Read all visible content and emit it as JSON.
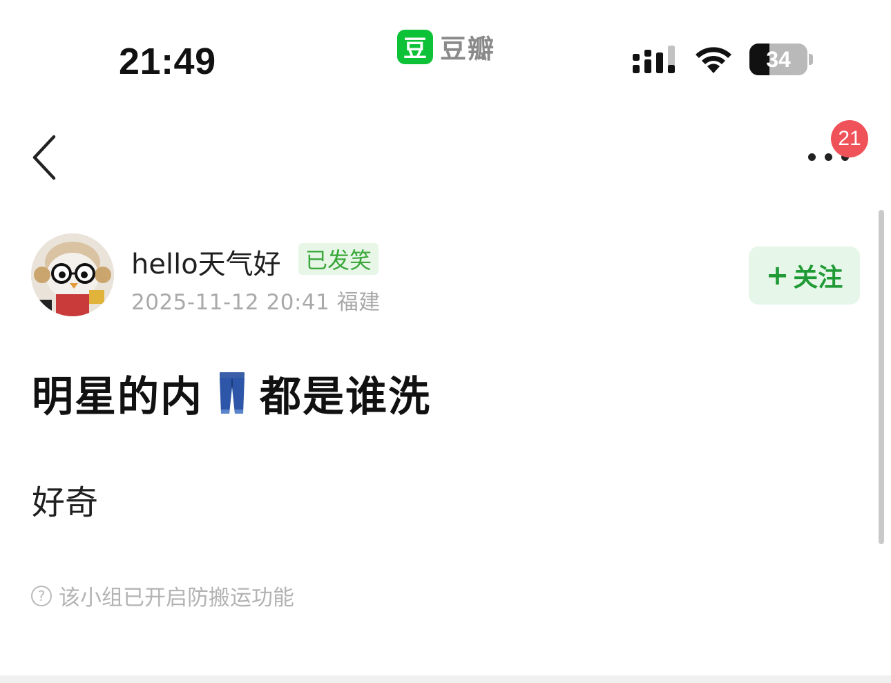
{
  "status_bar": {
    "time": "21:49",
    "app_logo_char": "豆",
    "app_name": "豆瓣",
    "battery_level": "34",
    "battery_fraction": 0.34,
    "icons": [
      "signal-icon",
      "wifi-icon",
      "battery-icon"
    ]
  },
  "nav": {
    "back_icon": "chevron-left-icon",
    "more_icon": "more-dots-icon",
    "notification_count": "21"
  },
  "author": {
    "name": "hello天气好",
    "tag": "已发笑",
    "meta": "2025-11-12 20:41  福建",
    "follow_plus": "+",
    "follow_label": "关注"
  },
  "post": {
    "title_before": "明星的内",
    "title_emoji": "jeans-icon",
    "title_after": "都是谁洗",
    "body": "好奇"
  },
  "notice": {
    "icon": "question-circle-icon",
    "icon_char": "?",
    "text": "该小组已开启防搬运功能"
  },
  "colors": {
    "brand_green": "#0ec238",
    "follow_text": "#1f9a35",
    "follow_bg": "#e6f6e8",
    "badge_red": "#f0525a",
    "tag_green": "#3aa83a"
  }
}
